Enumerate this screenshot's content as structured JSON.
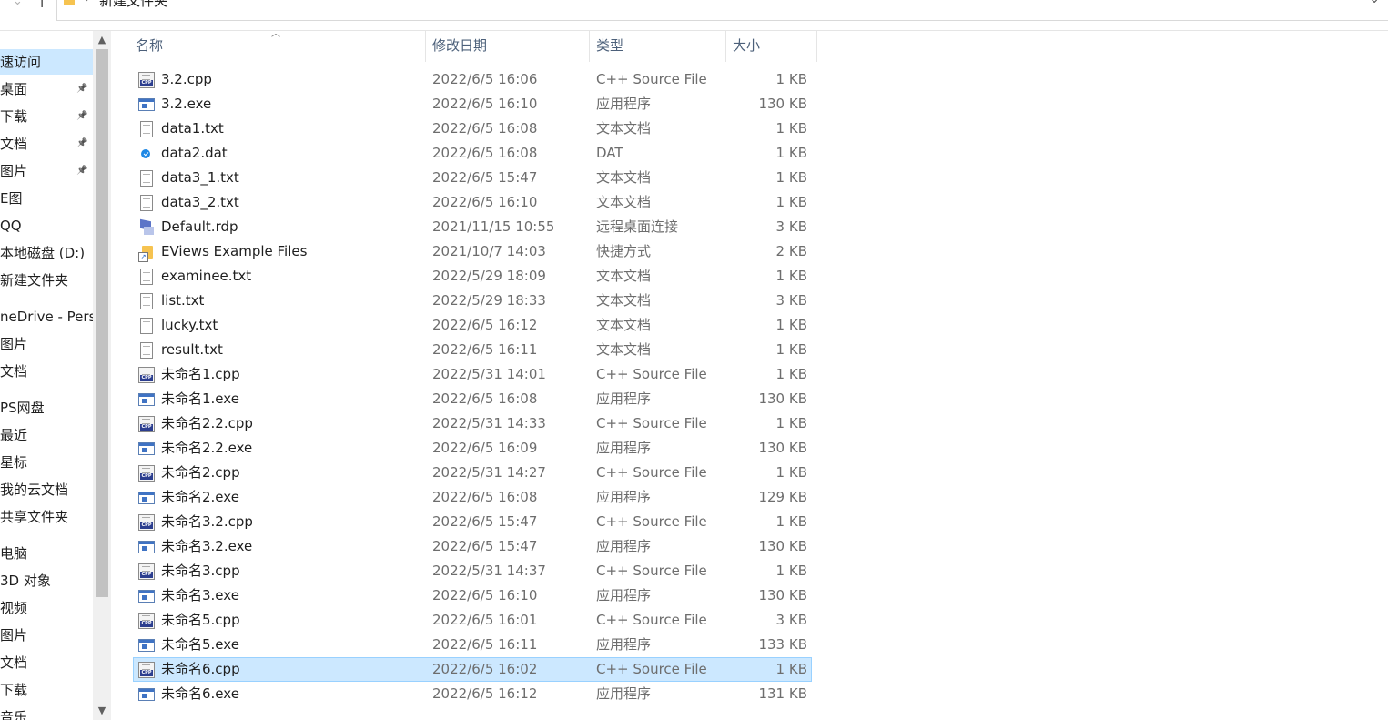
{
  "address_bar": {
    "path_segment": "新建文件夹",
    "back_icon": "chevron-down-icon",
    "up_icon": "arrow-up-icon",
    "dropdown_icon": "chevron-down-icon"
  },
  "nav_pane": {
    "items": [
      {
        "label": "速访问",
        "pinned": false,
        "selected": true
      },
      {
        "label": "桌面",
        "pinned": true
      },
      {
        "label": "下载",
        "pinned": true
      },
      {
        "label": "文档",
        "pinned": true
      },
      {
        "label": "图片",
        "pinned": true
      },
      {
        "label": "E图",
        "pinned": false
      },
      {
        "label": "QQ",
        "pinned": false
      },
      {
        "label": "本地磁盘 (D:)",
        "pinned": false
      },
      {
        "label": "新建文件夹",
        "pinned": false
      },
      {
        "label": "neDrive - Perso",
        "pinned": false
      },
      {
        "label": "图片",
        "pinned": false
      },
      {
        "label": "文档",
        "pinned": false
      },
      {
        "label": "PS网盘",
        "pinned": false
      },
      {
        "label": "最近",
        "pinned": false
      },
      {
        "label": "星标",
        "pinned": false
      },
      {
        "label": "我的云文档",
        "pinned": false
      },
      {
        "label": "共享文件夹",
        "pinned": false
      },
      {
        "label": "电脑",
        "pinned": false
      },
      {
        "label": "3D 对象",
        "pinned": false
      },
      {
        "label": "视频",
        "pinned": false
      },
      {
        "label": "图片",
        "pinned": false
      },
      {
        "label": "文档",
        "pinned": false
      },
      {
        "label": "下载",
        "pinned": false
      },
      {
        "label": "音乐",
        "pinned": false
      }
    ]
  },
  "columns": {
    "name": "名称",
    "date": "修改日期",
    "type": "类型",
    "size": "大小"
  },
  "files": [
    {
      "icon": "cpp",
      "name": "3.2.cpp",
      "date": "2022/6/5 16:06",
      "type": "C++ Source File",
      "size": "1 KB"
    },
    {
      "icon": "exe",
      "name": "3.2.exe",
      "date": "2022/6/5 16:10",
      "type": "应用程序",
      "size": "130 KB"
    },
    {
      "icon": "txt",
      "name": "data1.txt",
      "date": "2022/6/5 16:08",
      "type": "文本文档",
      "size": "1 KB"
    },
    {
      "icon": "dat",
      "name": "data2.dat",
      "date": "2022/6/5 16:08",
      "type": "DAT",
      "size": "1 KB"
    },
    {
      "icon": "txt",
      "name": "data3_1.txt",
      "date": "2022/6/5 15:47",
      "type": "文本文档",
      "size": "1 KB"
    },
    {
      "icon": "txt",
      "name": "data3_2.txt",
      "date": "2022/6/5 16:10",
      "type": "文本文档",
      "size": "1 KB"
    },
    {
      "icon": "rdp",
      "name": "Default.rdp",
      "date": "2021/11/15 10:55",
      "type": "远程桌面连接",
      "size": "3 KB"
    },
    {
      "icon": "lnk",
      "name": "EViews Example Files",
      "date": "2021/10/7 14:03",
      "type": "快捷方式",
      "size": "2 KB"
    },
    {
      "icon": "txt",
      "name": "examinee.txt",
      "date": "2022/5/29 18:09",
      "type": "文本文档",
      "size": "1 KB"
    },
    {
      "icon": "txt",
      "name": "list.txt",
      "date": "2022/5/29 18:33",
      "type": "文本文档",
      "size": "3 KB"
    },
    {
      "icon": "txt",
      "name": "lucky.txt",
      "date": "2022/6/5 16:12",
      "type": "文本文档",
      "size": "1 KB"
    },
    {
      "icon": "txt",
      "name": "result.txt",
      "date": "2022/6/5 16:11",
      "type": "文本文档",
      "size": "1 KB"
    },
    {
      "icon": "cpp",
      "name": "未命名1.cpp",
      "date": "2022/5/31 14:01",
      "type": "C++ Source File",
      "size": "1 KB"
    },
    {
      "icon": "exe",
      "name": "未命名1.exe",
      "date": "2022/6/5 16:08",
      "type": "应用程序",
      "size": "130 KB"
    },
    {
      "icon": "cpp",
      "name": "未命名2.2.cpp",
      "date": "2022/5/31 14:33",
      "type": "C++ Source File",
      "size": "1 KB"
    },
    {
      "icon": "exe",
      "name": "未命名2.2.exe",
      "date": "2022/6/5 16:09",
      "type": "应用程序",
      "size": "130 KB"
    },
    {
      "icon": "cpp",
      "name": "未命名2.cpp",
      "date": "2022/5/31 14:27",
      "type": "C++ Source File",
      "size": "1 KB"
    },
    {
      "icon": "exe",
      "name": "未命名2.exe",
      "date": "2022/6/5 16:08",
      "type": "应用程序",
      "size": "129 KB"
    },
    {
      "icon": "cpp",
      "name": "未命名3.2.cpp",
      "date": "2022/6/5 15:47",
      "type": "C++ Source File",
      "size": "1 KB"
    },
    {
      "icon": "exe",
      "name": "未命名3.2.exe",
      "date": "2022/6/5 15:47",
      "type": "应用程序",
      "size": "130 KB"
    },
    {
      "icon": "cpp",
      "name": "未命名3.cpp",
      "date": "2022/5/31 14:37",
      "type": "C++ Source File",
      "size": "1 KB"
    },
    {
      "icon": "exe",
      "name": "未命名3.exe",
      "date": "2022/6/5 16:10",
      "type": "应用程序",
      "size": "130 KB"
    },
    {
      "icon": "cpp",
      "name": "未命名5.cpp",
      "date": "2022/6/5 16:01",
      "type": "C++ Source File",
      "size": "3 KB"
    },
    {
      "icon": "exe",
      "name": "未命名5.exe",
      "date": "2022/6/5 16:11",
      "type": "应用程序",
      "size": "133 KB"
    },
    {
      "icon": "cpp",
      "name": "未命名6.cpp",
      "date": "2022/6/5 16:02",
      "type": "C++ Source File",
      "size": "1 KB",
      "selected": true
    },
    {
      "icon": "exe",
      "name": "未命名6.exe",
      "date": "2022/6/5 16:12",
      "type": "应用程序",
      "size": "131 KB"
    }
  ],
  "colors": {
    "selection_bg": "#cce8ff",
    "selection_border": "#99d1ff",
    "header_text": "#4c607a",
    "secondary_text": "#6d6d6d"
  }
}
